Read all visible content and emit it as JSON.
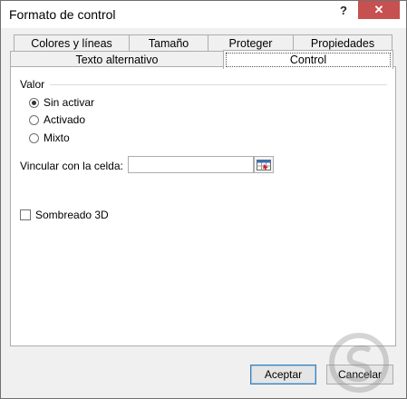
{
  "window": {
    "title": "Formato de control",
    "help_glyph": "?",
    "close_glyph": "✕"
  },
  "tabs": {
    "row1": [
      "Colores y líneas",
      "Tamaño",
      "Proteger",
      "Propiedades"
    ],
    "row2": [
      "Texto alternativo",
      "Control"
    ],
    "active": "Control"
  },
  "valor": {
    "group_label": "Valor",
    "options": [
      {
        "label": "Sin activar",
        "accel": "S",
        "checked": true
      },
      {
        "label": "Activado",
        "accel": "A",
        "checked": false
      },
      {
        "label": "Mixto",
        "accel": "M",
        "checked": false
      }
    ]
  },
  "link": {
    "label": "Vincular con la celda:",
    "accel": "V",
    "value": "",
    "picker_icon": "range-select-icon"
  },
  "shading": {
    "label": "Sombreado 3D",
    "accel": "3",
    "checked": false
  },
  "buttons": {
    "ok": "Aceptar",
    "cancel": "Cancelar"
  },
  "colors": {
    "close_button": "#c75050",
    "default_button_border": "#3c7fb1",
    "dialog_bg": "#f0f0f0"
  }
}
